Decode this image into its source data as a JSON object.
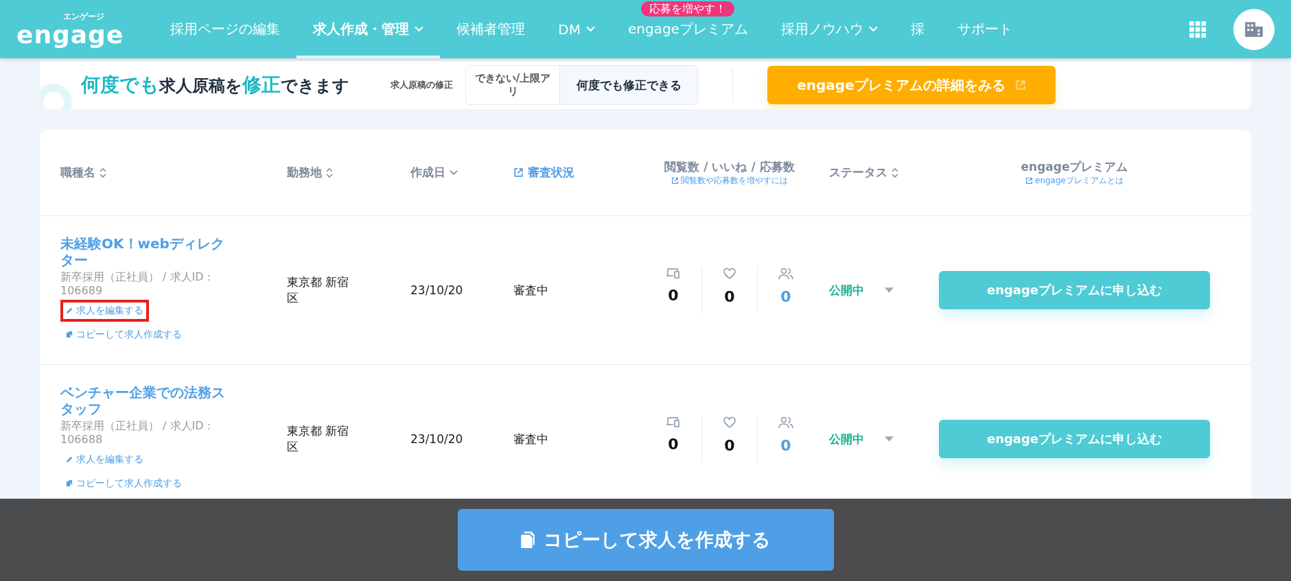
{
  "header": {
    "logo": "engage",
    "logo_kana": "エンゲージ",
    "nav": [
      {
        "label": "採用ページの編集",
        "selected": false,
        "dropdown": false
      },
      {
        "label": "求人作成・管理",
        "selected": true,
        "dropdown": true
      },
      {
        "label": "候補者管理",
        "selected": false,
        "dropdown": false
      },
      {
        "label": "DM",
        "selected": false,
        "dropdown": true
      },
      {
        "label": "engageプレミアム",
        "selected": false,
        "dropdown": false,
        "badge": "応募を増やす！"
      },
      {
        "label": "採用ノウハウ",
        "selected": false,
        "dropdown": true
      },
      {
        "label": "採",
        "selected": false,
        "dropdown": false
      },
      {
        "label": "サポート",
        "selected": false,
        "dropdown": false
      }
    ]
  },
  "banner": {
    "headline": [
      {
        "text": "何度でも",
        "accent": true
      },
      {
        "text": "求人原稿を",
        "accent": false
      },
      {
        "text": "修正",
        "accent": true
      },
      {
        "text": "できます",
        "accent": false
      }
    ],
    "compare_label": "求人原稿の修正",
    "compare_left": "できない/上限アリ",
    "compare_right": "何度でも修正できる",
    "cta": "engageプレミアムの詳細をみる"
  },
  "table": {
    "columns": [
      {
        "label": "職種名",
        "kind": "sort"
      },
      {
        "label": "勤務地",
        "kind": "sort"
      },
      {
        "label": "作成日",
        "kind": "desc"
      },
      {
        "label": "審査状況",
        "kind": "link"
      },
      {
        "label": "閲覧数 / いいね / 応募数",
        "kind": "sub",
        "sublink": "閲覧数や応募数を増やすには"
      },
      {
        "label": "ステータス",
        "kind": "sort"
      },
      {
        "label": "engageプレミアム",
        "kind": "sub",
        "sublink": "engageプレミアムとは"
      }
    ],
    "rows": [
      {
        "title": "未経験OK！webディレクター",
        "meta": "新卒採用（正社員） / 求人ID : 106689",
        "edit": "求人を編集する",
        "copy": "コピーして求人作成する",
        "highlighted": true,
        "location": "東京都 新宿区",
        "date": "23/10/20",
        "review": "審査中",
        "views": "0",
        "likes": "0",
        "applies": "0",
        "status": "公開中",
        "action": "engageプレミアムに申し込む"
      },
      {
        "title": "ベンチャー企業での法務スタッフ",
        "meta": "新卒採用（正社員） / 求人ID : 106688",
        "edit": "求人を編集する",
        "copy": "コピーして求人作成する",
        "highlighted": false,
        "location": "東京都 新宿区",
        "date": "23/10/20",
        "review": "審査中",
        "views": "0",
        "likes": "0",
        "applies": "0",
        "status": "公開中",
        "action": "engageプレミアムに申し込む"
      }
    ]
  },
  "footer_button": "コピーして求人を作成する"
}
